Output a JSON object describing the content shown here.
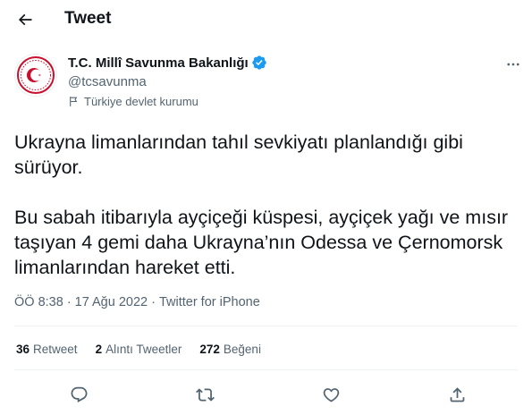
{
  "header": {
    "title": "Tweet",
    "back_icon": "arrow-left-icon"
  },
  "author": {
    "name": "T.C. Millî Savunma Bakanlığı",
    "handle": "@tcsavunma",
    "verified_icon": "verified-badge-icon",
    "affiliation": "Türkiye devlet kurumu",
    "affiliation_icon": "flag-icon",
    "more_icon": "more-horizontal-icon"
  },
  "tweet": {
    "paragraph_1": "Ukrayna limanlarından tahıl sevkiyatı planlandığı gibi sürüyor.",
    "paragraph_2": "Bu sabah itibarıyla ayçiçeği küspesi, ayçiçek yağı ve mısır taşıyan 4 gemi daha Ukrayna’nın Odessa ve Çernomorsk limanlarından hareket etti."
  },
  "meta": {
    "time": "ÖÖ 8:38",
    "sep1": "·",
    "date": "17 Ağu 2022",
    "sep2": "·",
    "source": "Twitter for iPhone"
  },
  "stats": {
    "retweets_count": "36",
    "retweets_label": "Retweet",
    "quotes_count": "2",
    "quotes_label": "Alıntı Tweetler",
    "likes_count": "272",
    "likes_label": "Beğeni"
  },
  "actions": {
    "reply_icon": "reply-icon",
    "retweet_icon": "retweet-icon",
    "like_icon": "heart-icon",
    "share_icon": "share-icon"
  },
  "colors": {
    "text_primary": "#0f1419",
    "text_secondary": "#536471",
    "verified_blue": "#1d9bf0",
    "emblem_red": "#c8102e",
    "divider": "#eff3f4"
  }
}
